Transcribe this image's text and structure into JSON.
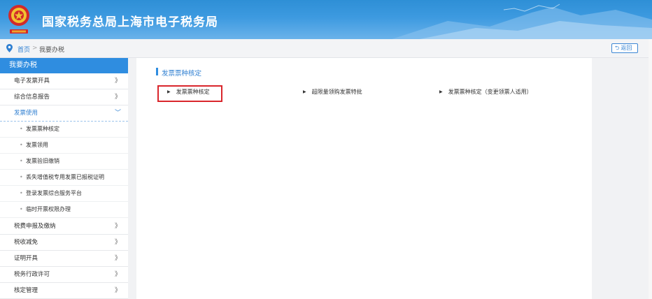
{
  "header": {
    "title": "国家税务总局上海市电子税务局",
    "emblem_icon": "tax-emblem-icon",
    "gradient_colors": [
      "#2e8fd6",
      "#6ab2ea"
    ]
  },
  "breadcrumb": {
    "home": "首页",
    "separator": ">",
    "current": "我要办税"
  },
  "back_button": {
    "icon": "return-arrow-icon",
    "label": "返回"
  },
  "sidebar": {
    "heading": "我要办税",
    "items": [
      {
        "label": "电子发票开具",
        "chevron": "》"
      },
      {
        "label": "综合信息报告",
        "chevron": "》"
      },
      {
        "label": "发票使用",
        "chevron": "﹀",
        "expanded": true
      },
      {
        "label": "税费申报及缴纳",
        "chevron": "》"
      },
      {
        "label": "税收减免",
        "chevron": "》"
      },
      {
        "label": "证明开具",
        "chevron": "》"
      },
      {
        "label": "税务行政许可",
        "chevron": "》"
      },
      {
        "label": "核定管理",
        "chevron": "》"
      }
    ],
    "sub_items": [
      {
        "label": "发票票种核定"
      },
      {
        "label": "发票领用"
      },
      {
        "label": "发票验旧缴销"
      },
      {
        "label": "丢失增值税专用发票已报税证明"
      },
      {
        "label": "登录发票综合服务平台"
      },
      {
        "label": "临时开票权限办理"
      }
    ],
    "accent_color": "#2f8de0"
  },
  "main": {
    "section_title": "发票票种核定",
    "links": [
      {
        "label": "发票票种核定",
        "highlighted": true
      },
      {
        "label": "超限量领购发票特批"
      },
      {
        "label": "发票票种核定（变更领票人适用）"
      }
    ],
    "highlight_color": "#d9262c"
  }
}
